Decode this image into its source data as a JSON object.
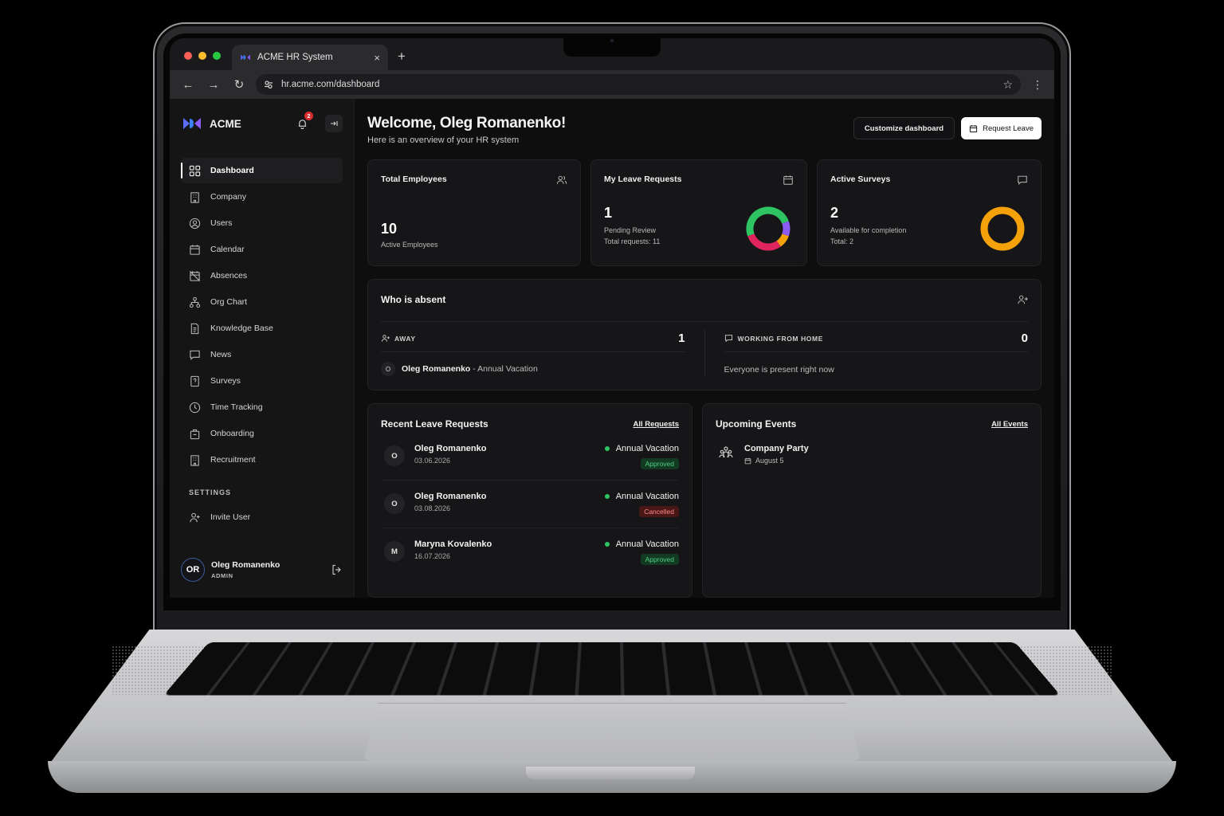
{
  "browser": {
    "tab_title": "ACME HR System",
    "url": "hr.acme.com/dashboard",
    "new_tab": "+",
    "close_tab": "×"
  },
  "sidebar": {
    "brand": "ACME",
    "notification_count": "2",
    "items": [
      {
        "label": "Dashboard",
        "icon": "grid-icon",
        "active": true
      },
      {
        "label": "Company",
        "icon": "building-icon"
      },
      {
        "label": "Users",
        "icon": "user-circle-icon"
      },
      {
        "label": "Calendar",
        "icon": "calendar-icon"
      },
      {
        "label": "Absences",
        "icon": "calendar-off-icon"
      },
      {
        "label": "Org Chart",
        "icon": "org-chart-icon"
      },
      {
        "label": "Knowledge Base",
        "icon": "document-icon"
      },
      {
        "label": "News",
        "icon": "message-icon"
      },
      {
        "label": "Surveys",
        "icon": "survey-icon"
      },
      {
        "label": "Time Tracking",
        "icon": "clock-icon"
      },
      {
        "label": "Onboarding",
        "icon": "briefcase-icon"
      },
      {
        "label": "Recruitment",
        "icon": "building-icon"
      }
    ],
    "settings_label": "SETTINGS",
    "settings_items": [
      {
        "label": "Invite User",
        "icon": "user-plus-icon"
      }
    ],
    "user": {
      "initials": "OR",
      "name": "Oleg Romanenko",
      "role": "ADMIN"
    }
  },
  "header": {
    "welcome": "Welcome, Oleg Romanenko!",
    "subtitle": "Here is an overview of your HR system",
    "customize_label": "Customize dashboard",
    "request_leave_label": "Request Leave"
  },
  "stats": {
    "employees": {
      "title": "Total Employees",
      "value": "10",
      "caption": "Active Employees"
    },
    "leave": {
      "title": "My Leave Requests",
      "value": "1",
      "caption": "Pending Review",
      "total": "Total requests: 11"
    },
    "surveys": {
      "title": "Active Surveys",
      "value": "2",
      "caption": "Available for completion",
      "total": "Total: 2"
    }
  },
  "absent": {
    "title": "Who is absent",
    "away_label": "AWAY",
    "away_count": "1",
    "away_person_initial": "O",
    "away_person": "Oleg Romanenko",
    "away_reason": " - Annual Vacation",
    "wfh_label": "WORKING FROM HOME",
    "wfh_count": "0",
    "wfh_note": "Everyone is present right now"
  },
  "recent": {
    "title": "Recent Leave Requests",
    "link": "All Requests",
    "requests": [
      {
        "initial": "O",
        "name": "Oleg Romanenko",
        "date": "03.06.2026",
        "type": "Annual Vacation",
        "status": "Approved"
      },
      {
        "initial": "O",
        "name": "Oleg Romanenko",
        "date": "03.08.2026",
        "type": "Annual Vacation",
        "status": "Cancelled"
      },
      {
        "initial": "M",
        "name": "Maryna Kovalenko",
        "date": "16.07.2026",
        "type": "Annual Vacation",
        "status": "Approved"
      }
    ]
  },
  "events": {
    "title": "Upcoming Events",
    "link": "All Events",
    "items": [
      {
        "title": "Company Party",
        "date": "August 5"
      }
    ]
  },
  "colors": {
    "approved": "#4cd080",
    "cancelled": "#ff8a8a",
    "status_dot": "#2ec463",
    "survey_ring": "#f5a10a",
    "leave_ring": [
      "#2ec463",
      "#8b5cf6",
      "#f5a10a",
      "#e0245e"
    ]
  }
}
